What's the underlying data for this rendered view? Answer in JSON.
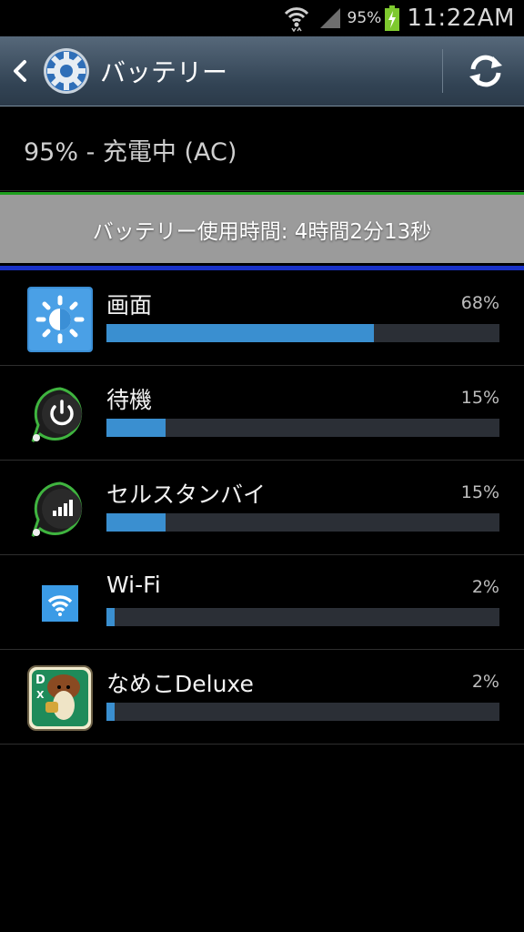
{
  "status_bar": {
    "battery_percent": "95%",
    "time": "11:22AM",
    "icons": [
      "wifi-icon",
      "signal-icon",
      "battery-charging-icon"
    ]
  },
  "action_bar": {
    "title": "バッテリー",
    "back_icon": "chevron-left-icon",
    "app_icon": "settings-gear-icon",
    "refresh_icon": "refresh-icon"
  },
  "charge_status": "95% - 充電中 (AC)",
  "usage_time": "バッテリー使用時間: 4時間2分13秒",
  "items": [
    {
      "label": "画面",
      "percent_text": "68%",
      "fraction": 0.68,
      "icon": "screen-brightness-icon"
    },
    {
      "label": "待機",
      "percent_text": "15%",
      "fraction": 0.15,
      "icon": "power-standby-icon"
    },
    {
      "label": "セルスタンバイ",
      "percent_text": "15%",
      "fraction": 0.15,
      "icon": "cell-signal-icon"
    },
    {
      "label": "Wi-Fi",
      "percent_text": "2%",
      "fraction": 0.02,
      "icon": "wifi-icon"
    },
    {
      "label": "なめこDeluxe",
      "percent_text": "2%",
      "fraction": 0.02,
      "icon": "nameko-app-icon"
    }
  ],
  "colors": {
    "bar_fill": "#3a8fd0",
    "bar_track": "#2b2f36",
    "accent_green": "#1fa01f",
    "accent_blue": "#1a32c8"
  }
}
